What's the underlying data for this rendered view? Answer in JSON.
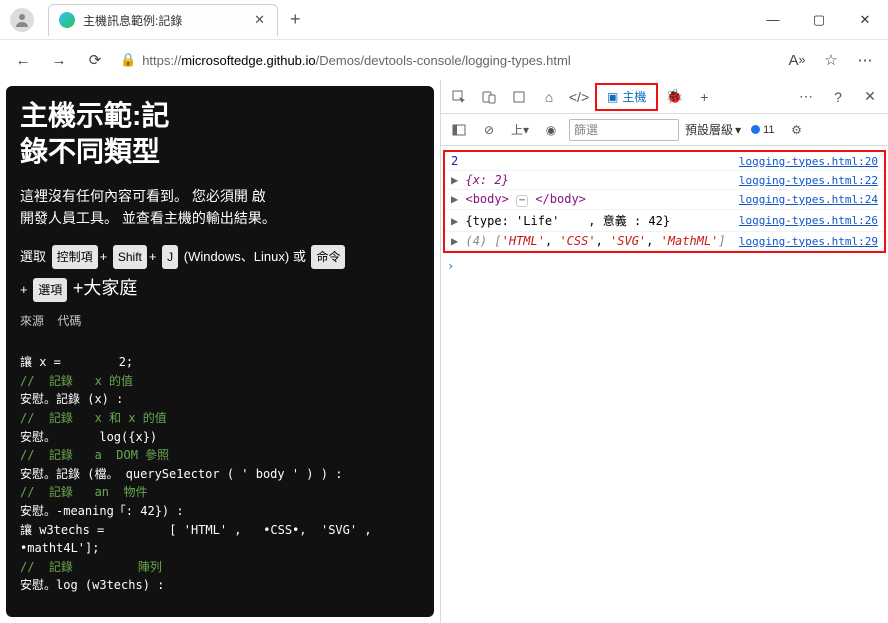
{
  "tab": {
    "title": "主機訊息範例:記錄"
  },
  "url": {
    "host": "microsoftedge.github.io",
    "path": "/Demos/devtools-console/logging-types.html",
    "scheme": "https://"
  },
  "page": {
    "heading1": "主機示範:記",
    "heading2": "錄不同類型",
    "para1": "這裡沒有任何內容可看到。 您必須開 啟",
    "para2": "開發人員工具。 並查看主機的輸出結果。",
    "row1_a": "選取",
    "row1_k1": "控制項",
    "row1_plus1": "+",
    "row1_k2": "Shift",
    "row1_plus2": "+",
    "row1_k3": "J",
    "row1_tail": "  (Windows、Linux) 或",
    "row1_k4": "命令",
    "row2_plus": "+",
    "row2_k": "選項",
    "row2_tail": "+大家庭",
    "code_head_a": "來源",
    "code_head_b": "代碼",
    "code_l1": "讓 x =        2;",
    "code_c1": "//  記錄   x 的值",
    "code_l2": "安慰。記錄 (x) :",
    "code_c2": "//  記錄   x 和 x 的值",
    "code_l3": "安慰。      log({x})",
    "code_c3": "//  記錄   a  DOM 參照",
    "code_l4": "安慰。記錄 (檔。 querySe1ector ( ' body ' ) ) :",
    "code_c4": "//  記錄   an  物件",
    "code_l5": "安慰。-meaning「: 42}) :",
    "code_l6": "讓 w3techs =         [ 'HTML' ,   •CSS•,  'SVG' ,  •matht4L'];",
    "code_c5": "//  記錄         陣列",
    "code_l7": "安慰。log (w3techs) :"
  },
  "devtools": {
    "tabs": {
      "console": "主機"
    },
    "issue_count": "11",
    "toolbar": {
      "top": "上",
      "filter_placeholder": "篩選",
      "level": "預設層級"
    },
    "rows": [
      {
        "left_html": "<span class='js-num'>2</span>",
        "src": "logging-types.html:20"
      },
      {
        "left_html": "<span class='caret'>▶</span> <span class='js-key'>{x: 2}</span>",
        "src": "logging-types.html:22"
      },
      {
        "left_html": "<span class='caret'>▶</span> <span class='dom-tag'>&lt;body&gt;</span> <span class='ellips'>⋯</span> <span class='dom-tag'>&lt;/body&gt;</span>",
        "src": "logging-types.html:24"
      },
      {
        "left_html": "<span class='caret'>▶</span> {type: 'Life'&nbsp;&nbsp;&nbsp;&nbsp;, 意義 : 42}",
        "src": "logging-types.html:26"
      },
      {
        "left_html": "<span class='caret'>▶</span> <span class='arr-gray'>(4)</span> <span class='arr-gray'>[</span><span class='arr-item'>'HTML'</span>, <span class='arr-item'>'CSS'</span>, <span class='arr-item'>'SVG'</span>, <span class='arr-item'>'MathML'</span><span class='arr-gray'>]</span>",
        "src": "logging-types.html:29"
      }
    ]
  }
}
